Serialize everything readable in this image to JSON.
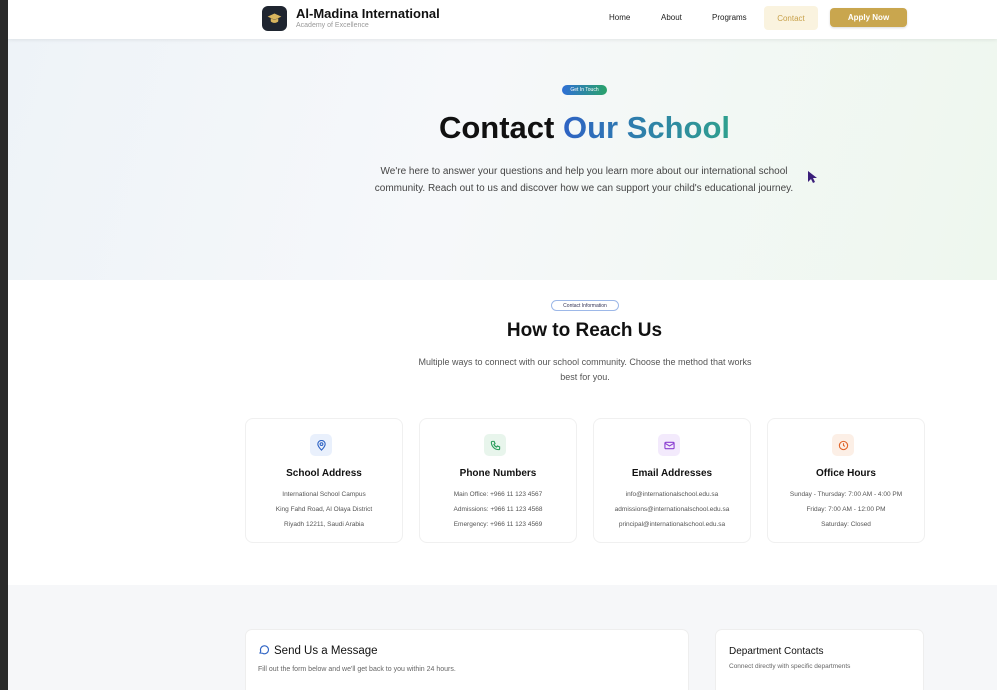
{
  "brand": {
    "name": "Al-Madina International",
    "tagline": "Academy of Excellence",
    "logo_icon": "graduation-cap-icon"
  },
  "nav": {
    "items": [
      "Home",
      "About",
      "Programs",
      "Contact"
    ],
    "active": "Contact",
    "cta": "Apply Now"
  },
  "hero": {
    "badge": "Get In Touch",
    "title_part1": "Contact",
    "title_part2": "Our School",
    "description": "We're here to answer your questions and help you learn more about our international school community. Reach out to us and discover how we can support your child's educational journey."
  },
  "reach": {
    "badge": "Contact Information",
    "title": "How to Reach Us",
    "description": "Multiple ways to connect with our school community. Choose the method that works best for you.",
    "cards": [
      {
        "icon": "map-pin-icon",
        "title": "School Address",
        "lines": [
          "International School Campus",
          "King Fahd Road, Al Olaya District",
          "Riyadh 12211, Saudi Arabia"
        ]
      },
      {
        "icon": "phone-icon",
        "title": "Phone Numbers",
        "lines": [
          "Main Office: +966 11 123 4567",
          "Admissions: +966 11 123 4568",
          "Emergency: +966 11 123 4569"
        ]
      },
      {
        "icon": "mail-icon",
        "title": "Email Addresses",
        "lines": [
          "info@internationalschool.edu.sa",
          "admissions@internationalschool.edu.sa",
          "principal@internationalschool.edu.sa"
        ]
      },
      {
        "icon": "clock-icon",
        "title": "Office Hours",
        "lines": [
          "Sunday - Thursday: 7:00 AM - 4:00 PM",
          "Friday: 7:00 AM - 12:00 PM",
          "Saturday: Closed"
        ]
      }
    ]
  },
  "message_form": {
    "icon": "chat-bubble-icon",
    "title": "Send Us a Message",
    "description": "Fill out the form below and we'll get back to you within 24 hours."
  },
  "departments": {
    "title": "Department Contacts",
    "description": "Connect directly with specific departments"
  },
  "colors": {
    "gold": "#c9a64e",
    "blue": "#2e63c4",
    "teal": "#2fa08e",
    "dark": "#1f2530"
  }
}
